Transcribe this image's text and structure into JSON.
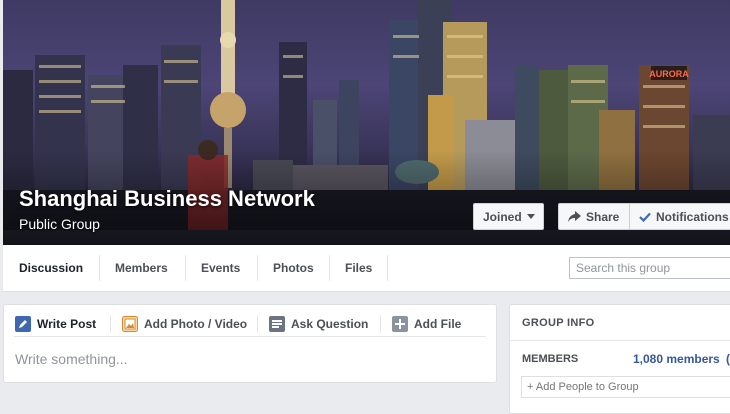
{
  "cover": {
    "group_name": "Shanghai Business Network",
    "privacy": "Public Group",
    "building_sign": "AURORA",
    "buttons": {
      "joined": "Joined",
      "share": "Share",
      "notifications": "Notifications"
    }
  },
  "nav": {
    "tabs": [
      {
        "label": "Discussion"
      },
      {
        "label": "Members"
      },
      {
        "label": "Events"
      },
      {
        "label": "Photos"
      },
      {
        "label": "Files"
      }
    ],
    "search_placeholder": "Search this group"
  },
  "composer": {
    "tabs": [
      {
        "label": "Write Post",
        "icon": "pencil-icon"
      },
      {
        "label": "Add Photo / Video",
        "icon": "photo-icon"
      },
      {
        "label": "Ask Question",
        "icon": "question-icon"
      },
      {
        "label": "Add File",
        "icon": "add-file-icon"
      }
    ],
    "placeholder": "Write something..."
  },
  "group_info": {
    "title": "GROUP INFO",
    "members_label": "MEMBERS",
    "members_count": "1,080 members",
    "members_extra": "(",
    "add_people_placeholder": "+ Add People to Group"
  },
  "colors": {
    "link": "#365899",
    "icon_blue": "#4267b2",
    "background": "#e9ebee"
  }
}
